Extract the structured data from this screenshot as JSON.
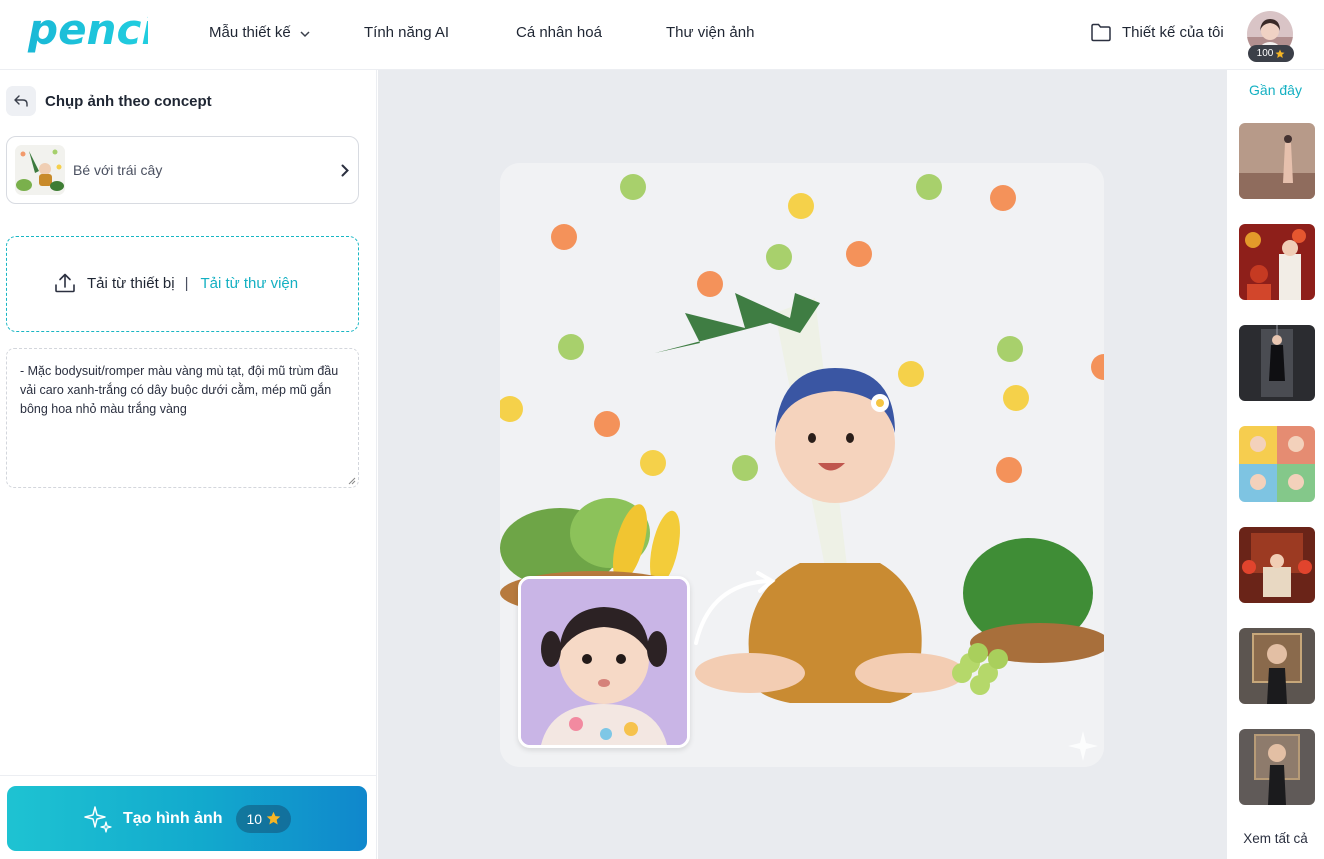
{
  "header": {
    "logo_text": "penci",
    "nav": [
      {
        "label": "Mẫu thiết kế"
      },
      {
        "label": "Tính năng AI"
      },
      {
        "label": "Cá nhân hoá"
      },
      {
        "label": "Thư viện ảnh"
      }
    ],
    "my_design_label": "Thiết kế của tôi",
    "credits": "100"
  },
  "left_panel": {
    "title": "Chụp ảnh theo concept",
    "concept_label": "Bé với trái cây",
    "upload_device_label": "Tải từ thiết bị",
    "upload_separator": "|",
    "upload_library_label": "Tải từ thư viện",
    "prompt_text": "- Mặc bodysuit/romper màu vàng mù tạt, đội mũ trùm đầu vải caro xanh-trắng có dây buộc dưới cằm, mép mũ gắn bông hoa nhỏ màu trắng vàng",
    "generate_label": "Tạo hình ảnh",
    "generate_cost": "10"
  },
  "right_panel": {
    "recent_title": "Gần đây",
    "see_all_label": "Xem tất cả"
  },
  "colors": {
    "accent": "#14b0c2",
    "button_gradient_start": "#1ec3d2",
    "button_gradient_end": "#1087cc",
    "star": "#f5b524"
  }
}
